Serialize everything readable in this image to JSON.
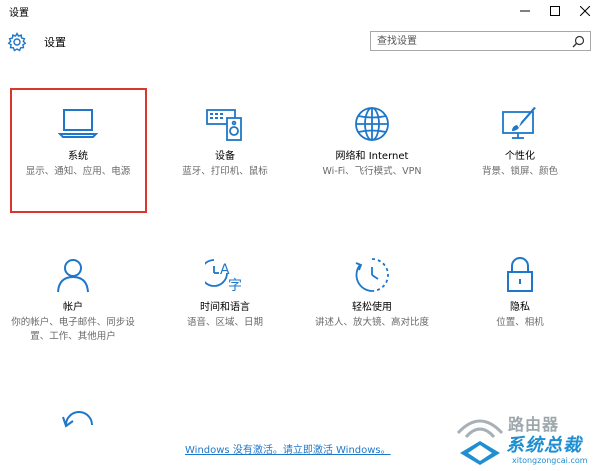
{
  "window": {
    "title": "设置",
    "controls": [
      "minimize-icon",
      "maximize-icon",
      "close-icon"
    ]
  },
  "header": {
    "icon": "gear-icon",
    "title": "设置",
    "search": {
      "value": "",
      "placeholder": "查找设置",
      "icon": "search-icon"
    }
  },
  "tiles": [
    {
      "icon": "laptop-icon",
      "name": "系统",
      "desc": "显示、通知、应用、电源",
      "selected": true
    },
    {
      "icon": "keyboard-speaker-icon",
      "name": "设备",
      "desc": "蓝牙、打印机、鼠标"
    },
    {
      "icon": "globe-icon",
      "name": "网络和 Internet",
      "desc": "Wi-Fi、飞行模式、VPN"
    },
    {
      "icon": "paint-screen-icon",
      "name": "个性化",
      "desc": "背景、锁屏、颜色"
    },
    {
      "icon": "person-icon",
      "name": "帐户",
      "desc": "你的帐户、电子邮件、同步设置、工作、其他用户"
    },
    {
      "icon": "language-icon",
      "name": "时间和语言",
      "desc": "语音、区域、日期"
    },
    {
      "icon": "ease-of-access-icon",
      "name": "轻松使用",
      "desc": "讲述人、放大镜、高对比度"
    },
    {
      "icon": "lock-icon",
      "name": "隐私",
      "desc": "位置、相机"
    },
    {
      "icon": "update-icon",
      "name": "",
      "desc": ""
    }
  ],
  "activation": {
    "text": "Windows 没有激活。请立即激活 Windows。"
  },
  "watermark": {
    "line1": "路由器",
    "line2": "系统总裁",
    "line3": "xitongzongcai.com"
  },
  "colors": {
    "accent": "#1f77c9",
    "highlight": "#d9372c"
  }
}
